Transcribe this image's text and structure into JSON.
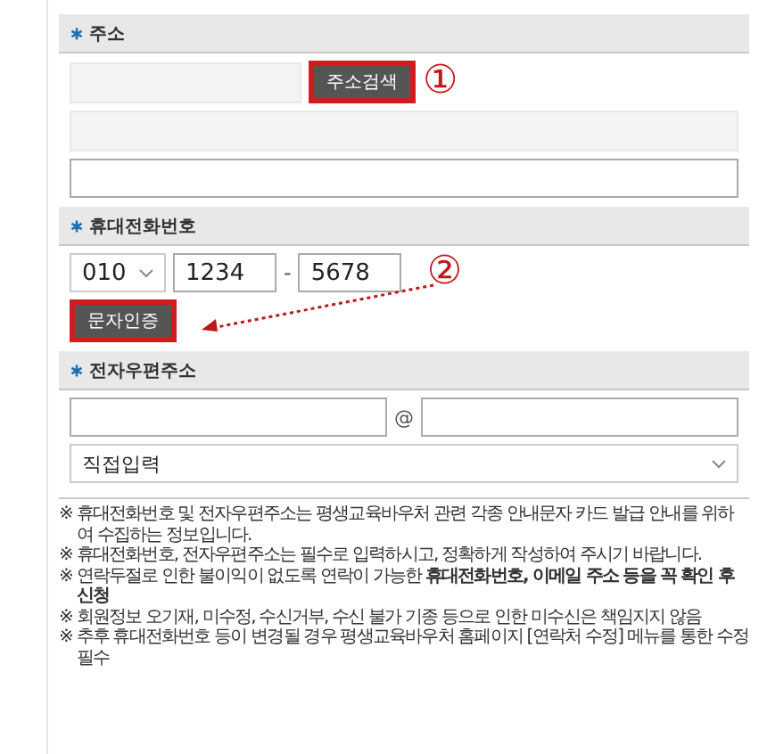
{
  "address": {
    "label": "주소",
    "search_button": "주소검색",
    "step": "①"
  },
  "phone": {
    "label": "휴대전화번호",
    "prefix": "010",
    "middle": "1234",
    "separator": "-",
    "last": "5678",
    "verify_button": "문자인증",
    "step": "②"
  },
  "email": {
    "label": "전자우편주소",
    "at": "@",
    "domain_select": "직접입력"
  },
  "notes": [
    "※ 휴대전화번호 및 전자우편주소는 평생교육바우처 관련 각종 안내문자 카드 발급 안내를 위하여 수집하는 정보입니다.",
    "※ 휴대전화번호, 전자우편주소는 필수로 입력하시고, 정확하게 작성하여 주시기 바랍니다.",
    "※ 연락두절로 인한 불이익이 없도록 연락이 가능한 **휴대전화번호, 이메일 주소 등을 꼭 확인 후 신청**",
    "※ 회원정보 오기재, 미수정, 수신거부, 수신 불가 기종 등으로 인한 미수신은 책임지지 않음",
    "※ 추후 휴대전화번호 등이 변경될 경우 평생교육바우처 홈페이지 [연락처 수정] 메뉴를 통한 수정 필수"
  ]
}
